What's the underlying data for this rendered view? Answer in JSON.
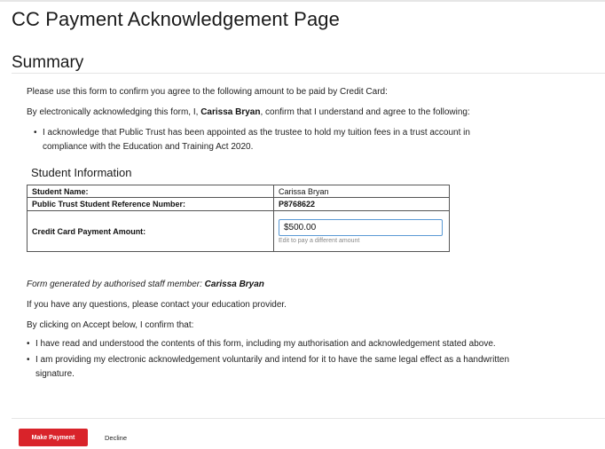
{
  "page": {
    "title": "CC Payment Acknowledgement Page"
  },
  "summary": {
    "heading": "Summary",
    "intro": "Please use this form to confirm you agree to the following amount to be paid by Credit Card:",
    "ack_prefix": "By electronically acknowledging this form, I, ",
    "ack_name": "Carissa Bryan",
    "ack_suffix": ", confirm that I understand and agree to the following:",
    "bullet_line1": "I acknowledge that Public Trust has been appointed as the trustee to hold my tuition fees in a trust account in",
    "bullet_line2": "compliance with the Education and Training Act 2020."
  },
  "student_info": {
    "heading": "Student Information",
    "rows": [
      {
        "label": "Student Name:",
        "value": "Carissa Bryan"
      },
      {
        "label": "Public Trust Student Reference Number:",
        "value": "P8768622"
      },
      {
        "label": "Credit Card Payment Amount:"
      }
    ],
    "amount_value": "$500.00",
    "amount_help": "Edit to pay a different amount"
  },
  "footer_text": {
    "generated_prefix": "Form generated by authorised staff member: ",
    "generated_name": "Carissa Bryan",
    "questions": "If you have any questions, please contact your education provider.",
    "confirm_intro": "By clicking on Accept below, I confirm that:",
    "confirm_items": [
      "I have read and understood the contents of this form, including my authorisation and acknowledgement stated above.",
      "I am providing my electronic acknowledgement voluntarily and intend for it to have the same legal effect as a handwritten"
    ],
    "confirm_item2_cont": "signature."
  },
  "actions": {
    "pay_label": "Make Payment",
    "decline_label": "Decline"
  },
  "colors": {
    "pay_button": "#d9232a",
    "input_border": "#5b9ad5"
  }
}
